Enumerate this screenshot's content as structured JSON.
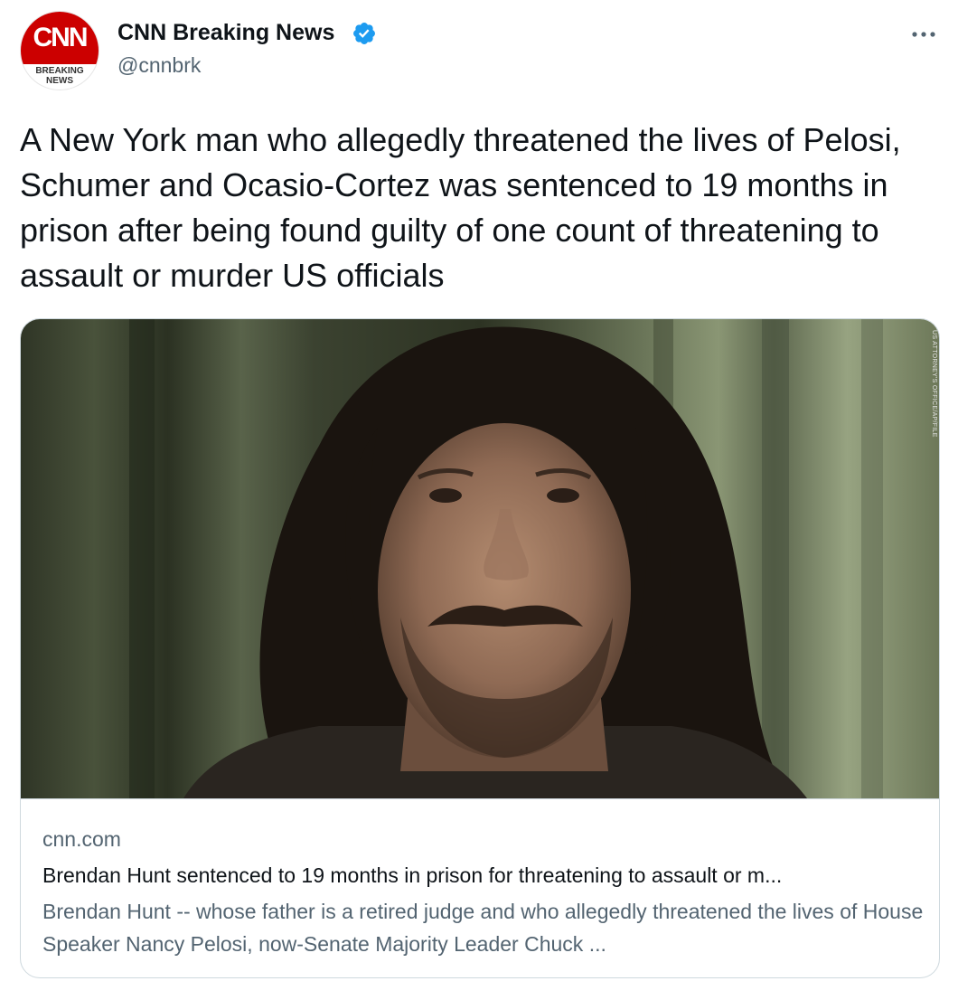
{
  "author": {
    "display_name": "CNN Breaking News",
    "handle": "@cnnbrk",
    "avatar": {
      "logo_text": "CNN",
      "sub_text": "BREAKING NEWS",
      "brand_color": "#cc0000"
    },
    "verified_icon": "verified-badge-icon",
    "verified_color": "#1d9bf0"
  },
  "more_menu_icon": "more-horizontal-icon",
  "tweet": {
    "text": "A New York man who allegedly threatened the lives of Pelosi, Schumer and Ocasio-Cortez was sentenced to 19 months in prison after being found guilty of one count of threatening to assault or murder US officials"
  },
  "card": {
    "image_credit": "US ATTORNEY'S OFFICE/AP/FILE",
    "domain": "cnn.com",
    "title": "Brendan Hunt sentenced to 19 months in prison for threatening to assault or m...",
    "description": "Brendan Hunt -- whose father is a retired judge and who allegedly threatened the lives of House Speaker Nancy Pelosi, now-Senate Majority Leader Chuck ..."
  },
  "colors": {
    "text_primary": "#0f1419",
    "text_secondary": "#536471",
    "border": "#cfd9de"
  }
}
